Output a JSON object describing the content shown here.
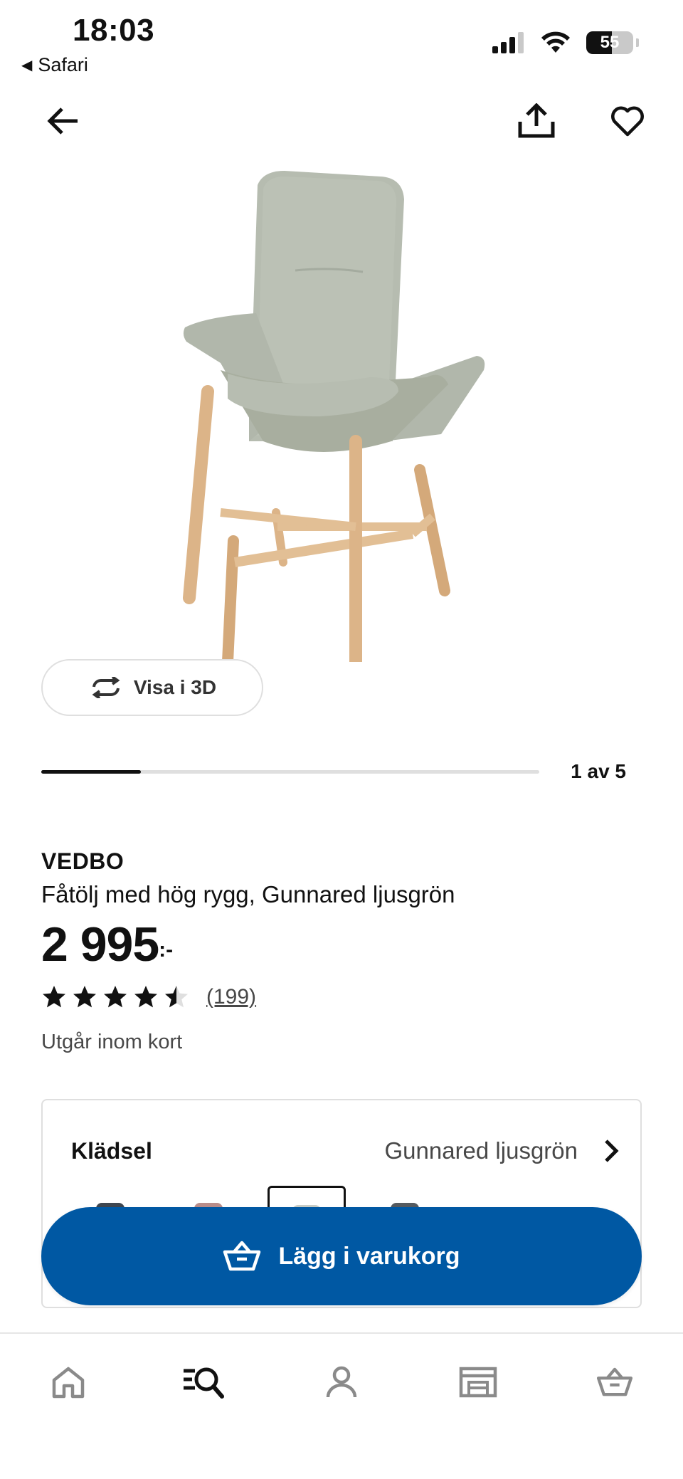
{
  "status_bar": {
    "time": "18:03",
    "back_app": "Safari",
    "battery": "55",
    "battery_level": 0.55,
    "icons": [
      "cellular-signal-icon",
      "wifi-icon",
      "battery-icon"
    ]
  },
  "top_bar": {
    "icons": [
      "arrow-left-icon",
      "share-icon",
      "heart-icon"
    ]
  },
  "gallery": {
    "view_3d_label": "Visa i 3D",
    "pager": "1 av 5",
    "progress": 0.2
  },
  "product": {
    "brand": "VEDBO",
    "description": "Fåtölj med hög rygg, Gunnared ljusgrön",
    "price": "2 995",
    "price_suffix": ":-",
    "rating": 4.5,
    "rating_count": "(199)",
    "status_note": "Utgår inom kort"
  },
  "variant": {
    "label": "Klädsel",
    "value": "Gunnared ljusgrön",
    "swatches": [
      {
        "color": "#3e4650",
        "selected": false
      },
      {
        "color": "#b98d8a",
        "selected": false
      },
      {
        "color": "#c9cdc6",
        "selected": true
      },
      {
        "color": "#555b60",
        "selected": false
      }
    ]
  },
  "cta": {
    "label": "Lägg i varukorg"
  },
  "bottom_nav": {
    "icons": [
      "home-icon",
      "search-icon",
      "profile-icon",
      "store-icon",
      "cart-icon"
    ]
  },
  "colors": {
    "primary_blue": "#0058a3",
    "text": "#111111",
    "muted_text": "#484848",
    "chair_fabric": "#b3b9ac",
    "chair_wood": "#dcb488"
  }
}
